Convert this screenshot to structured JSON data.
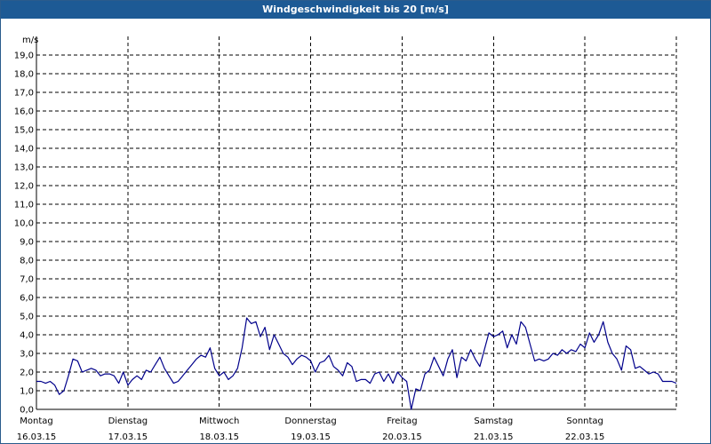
{
  "window": {
    "title": "Windgeschwindigkeit bis 20 [m/s]"
  },
  "chart_data": {
    "type": "line",
    "title": "Windgeschwindigkeit bis 20 [m/s]",
    "ylabel": "m/s",
    "ylim": [
      0,
      20
    ],
    "yticks": [
      "0,0",
      "1,0",
      "2,0",
      "3,0",
      "4,0",
      "5,0",
      "6,0",
      "7,0",
      "8,0",
      "9,0",
      "10,0",
      "11,0",
      "12,0",
      "13,0",
      "14,0",
      "15,0",
      "16,0",
      "17,0",
      "18,0",
      "19,0"
    ],
    "xlim": [
      0,
      7
    ],
    "days": [
      {
        "name": "Montag",
        "date": "16.03.15"
      },
      {
        "name": "Dienstag",
        "date": "17.03.15"
      },
      {
        "name": "Mittwoch",
        "date": "18.03.15"
      },
      {
        "name": "Donnerstag",
        "date": "19.03.15"
      },
      {
        "name": "Freitag",
        "date": "20.03.15"
      },
      {
        "name": "Samstag",
        "date": "21.03.15"
      },
      {
        "name": "Sonntag",
        "date": "22.03.15"
      }
    ],
    "grid": true,
    "series": [
      {
        "color": "#00008b",
        "x": [
          0.0,
          0.05,
          0.1,
          0.15,
          0.2,
          0.25,
          0.3,
          0.35,
          0.4,
          0.45,
          0.5,
          0.55,
          0.6,
          0.65,
          0.7,
          0.75,
          0.8,
          0.85,
          0.9,
          0.95,
          1.0,
          1.05,
          1.1,
          1.15,
          1.2,
          1.25,
          1.3,
          1.35,
          1.4,
          1.45,
          1.5,
          1.55,
          1.6,
          1.65,
          1.7,
          1.75,
          1.8,
          1.85,
          1.9,
          1.95,
          2.0,
          2.05,
          2.1,
          2.15,
          2.2,
          2.25,
          2.3,
          2.35,
          2.4,
          2.45,
          2.5,
          2.55,
          2.6,
          2.65,
          2.7,
          2.75,
          2.8,
          2.85,
          2.9,
          2.95,
          3.0,
          3.05,
          3.1,
          3.15,
          3.2,
          3.25,
          3.3,
          3.35,
          3.4,
          3.45,
          3.5,
          3.55,
          3.6,
          3.65,
          3.7,
          3.75,
          3.8,
          3.85,
          3.9,
          3.95,
          4.0,
          4.05,
          4.1,
          4.15,
          4.2,
          4.25,
          4.3,
          4.35,
          4.4,
          4.45,
          4.5,
          4.55,
          4.6,
          4.65,
          4.7,
          4.75,
          4.8,
          4.85,
          4.9,
          4.95,
          5.0,
          5.05,
          5.1,
          5.15,
          5.2,
          5.25,
          5.3,
          5.35,
          5.4,
          5.45,
          5.5,
          5.55,
          5.6,
          5.65,
          5.7,
          5.75,
          5.8,
          5.85,
          5.9,
          5.95,
          6.0,
          6.05,
          6.1,
          6.15,
          6.2,
          6.25,
          6.3,
          6.35,
          6.4,
          6.45,
          6.5,
          6.55,
          6.6,
          6.65,
          6.7,
          6.75,
          6.8,
          6.85,
          6.9,
          6.95,
          7.0
        ],
        "y": [
          1.5,
          1.5,
          1.4,
          1.5,
          1.3,
          0.8,
          1.0,
          1.8,
          2.7,
          2.6,
          2.0,
          2.1,
          2.2,
          2.1,
          1.8,
          1.9,
          1.9,
          1.8,
          1.4,
          2.0,
          1.3,
          1.6,
          1.8,
          1.6,
          2.1,
          2.0,
          2.4,
          2.8,
          2.2,
          1.8,
          1.4,
          1.5,
          1.8,
          2.1,
          2.4,
          2.7,
          2.9,
          2.8,
          3.3,
          2.2,
          1.8,
          2.0,
          1.6,
          1.8,
          2.2,
          3.3,
          4.9,
          4.6,
          4.7,
          3.9,
          4.4,
          3.2,
          4.0,
          3.5,
          3.0,
          2.8,
          2.4,
          2.7,
          2.9,
          2.8,
          2.6,
          2.0,
          2.5,
          2.6,
          2.9,
          2.3,
          2.1,
          1.8,
          2.5,
          2.3,
          1.5,
          1.6,
          1.6,
          1.4,
          1.9,
          2.0,
          1.5,
          1.9,
          1.4,
          2.0,
          1.7,
          1.5,
          0.0,
          1.1,
          1.0,
          1.9,
          2.1,
          2.8,
          2.3,
          1.8,
          2.7,
          3.2,
          1.7,
          2.8,
          2.6,
          3.2,
          2.7,
          2.3,
          3.2,
          4.1,
          3.9,
          4.0,
          4.2,
          3.3,
          4.0,
          3.5,
          4.7,
          4.4,
          3.5,
          2.6,
          2.7,
          2.6,
          2.7,
          3.0,
          2.9,
          3.2,
          3.0,
          3.2,
          3.1,
          3.5,
          3.3,
          4.1,
          3.6,
          4.0,
          4.7,
          3.6,
          3.0,
          2.7,
          2.1,
          3.4,
          3.2,
          2.2,
          2.3,
          2.1,
          1.9,
          2.0,
          1.9,
          1.5,
          1.5,
          1.5,
          1.4
        ]
      }
    ]
  }
}
